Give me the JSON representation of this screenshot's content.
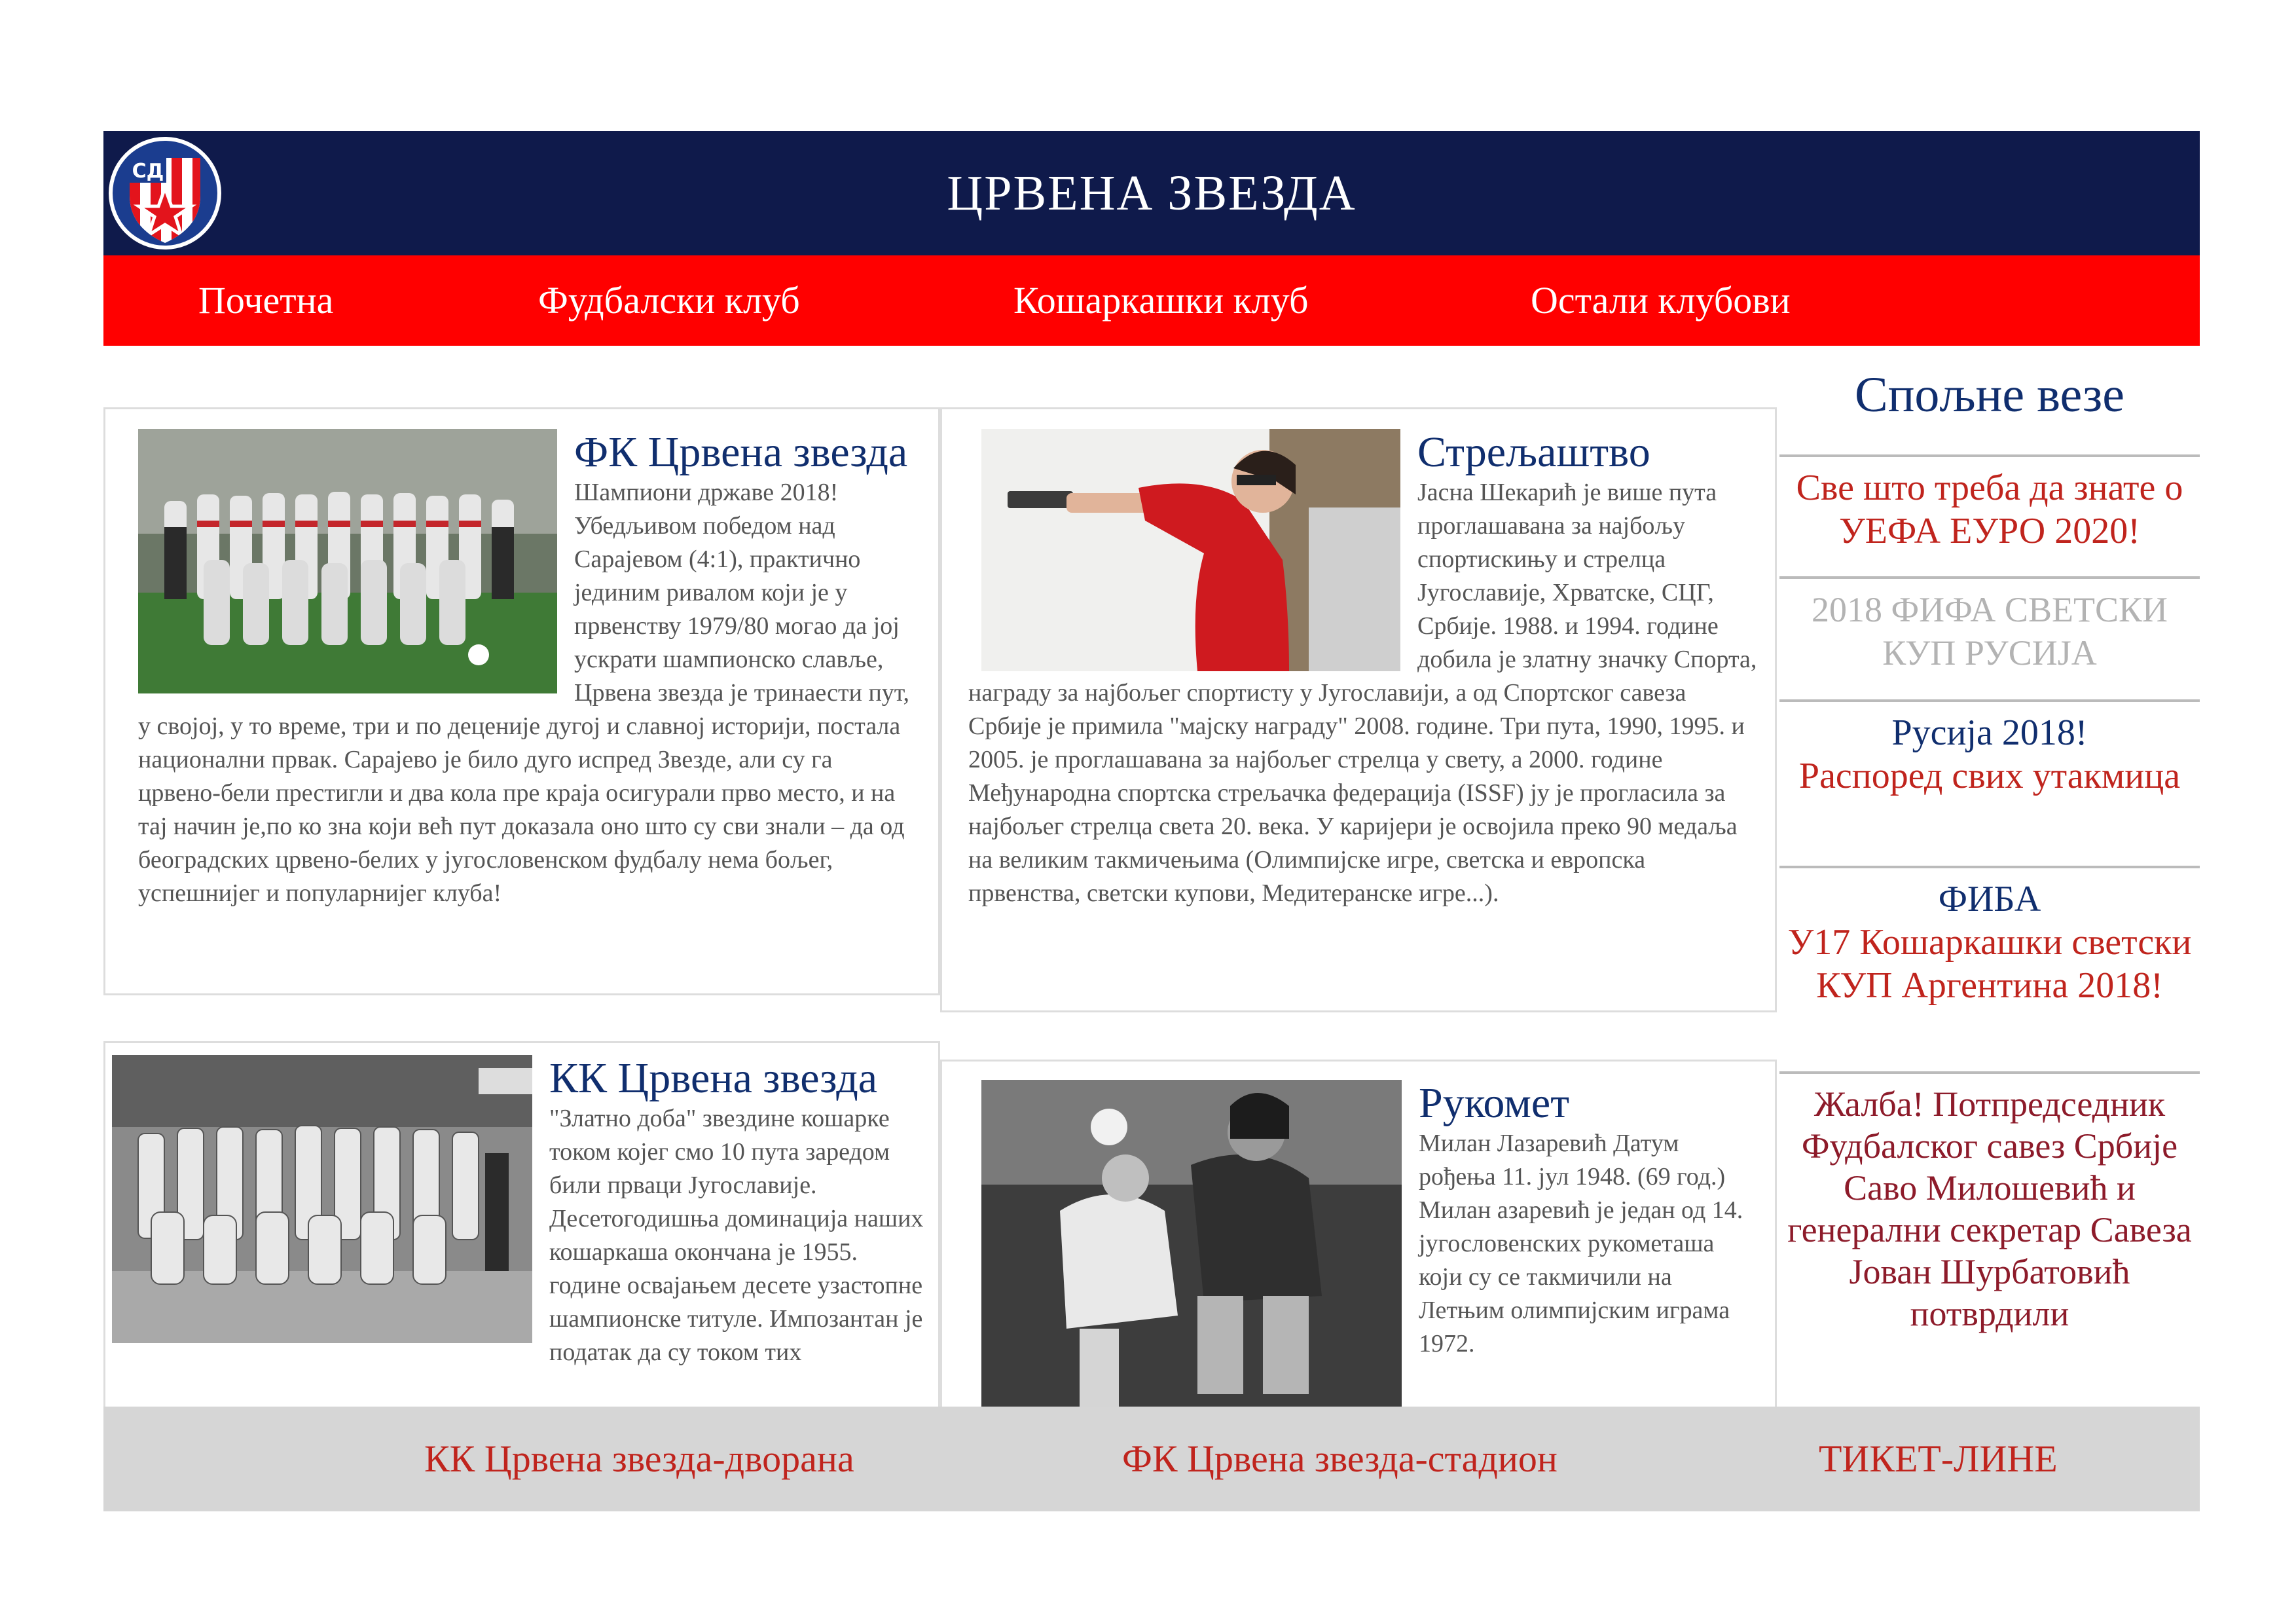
{
  "header": {
    "logo_text": "СД",
    "title": "ЦРВЕНА ЗВЕЗДА"
  },
  "nav": [
    "Почетна",
    "Фудбалски клуб",
    "Кошаркашки клуб",
    "Остали клубови"
  ],
  "articles": {
    "football": {
      "title": "ФК Црвена звезда",
      "body": "Шампиони државе 2018! Убедљивом победом над Сарајевом (4:1), практично јединим ривалом који је у првенству 1979/80 могао да јој ускрати шампионско славље, Црвена звезда је тринаести пут, у својој, у то време, три и по деценије дугој и славној историји, постала национални првак. Сарајево је било дуго испред Звезде, али су га црвено-бели престигли и два кола пре краја осигурали прво место, и на тај начин је,по ко зна који већ пут доказала оно што су сви знали – да од београдских црвено-белих у југословенском фудбалу нема бољег, успешнијег и популарнијег клуба!"
    },
    "shooting": {
      "title": "Стрељаштво",
      "body": "Јасна Шекарић је више пута проглашавана за најбољу спортискињу и стрелца Југославије, Хрватске, СЦГ, Србије. 1988. и 1994. године добила је златну значку Спорта, награду за најбољег спортисту у Југославији, а од Спортског савеза Србије је примила \"мајску награду\" 2008. године. Три пута, 1990, 1995. и 2005. је проглашавана за најбољег стрелца у свету, а 2000. године Међународна спортска стрељачка федерација (ISSF) ју је прогласила за најбољег стрелца света 20. века. У каријери је освојила преко 90 медаља на великим такмичењима (Олимпијске игре, светска и европска првенства, светски купови, Медитеранске игре...)."
    },
    "basketball": {
      "title": "КК Црвена звезда",
      "body": "\"Златно доба\" звездине кошарке током којег смо 10 пута заредом били прваци Југославије. Десетогодишња доминација наших кошаркаша окончана је 1955. године освајањем десете узастопне шампионске титуле. Импозантан је податак да су током тих"
    },
    "handball": {
      "title": "Рукомет",
      "body": "Милан Лазаревић Датум рођења 11. јул 1948. (69 год.) Милан азаревић је један од 14. југословенских рукометаша који су се такмичили на Летњим олимпијским играма 1972."
    }
  },
  "external_links": {
    "title": "Спољне везе",
    "euro": "Све што треба да знате о УЕФА ЕУРО 2020!",
    "fifa_wc": "2018 ФИФА СВЕТСКИ КУП РУСИЈА",
    "russia_a": "Русија 2018!",
    "russia_b": "Распоред свих утакмица",
    "fiba_a": "ФИБА",
    "fiba_b": "У17 Кошаркашки светски КУП Аргентина 2018!",
    "complaint": "Жалба! Потпредседник Фудбалског савез Србије Саво Милошевић и генерални секретар Савеза Јован Шурбатовић потврдили"
  },
  "footer": [
    "КК Црвена звезда-дворана",
    "ФК Црвена звезда-стадион",
    "ТИКЕТ-ЛИНЕ"
  ],
  "colors": {
    "navy": "#0f1a4b",
    "red": "#ff0000",
    "title_blue": "#102e6e",
    "link_red": "#c0241d",
    "footer_gray": "#d6d6d6"
  }
}
